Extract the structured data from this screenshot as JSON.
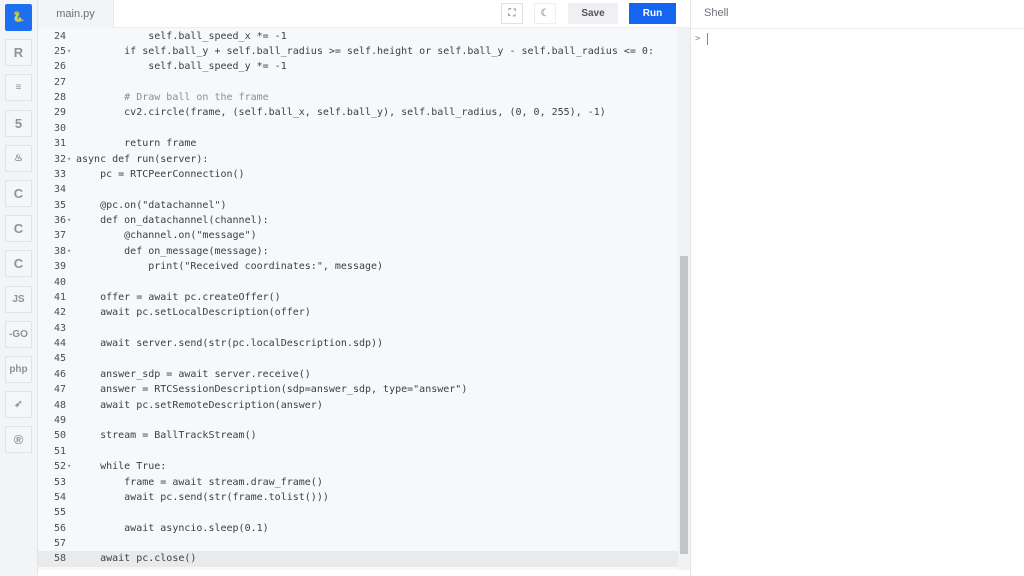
{
  "sidebar": {
    "items": [
      {
        "icon": "python-icon",
        "glyph": "🐍",
        "active": true
      },
      {
        "icon": "r-icon",
        "glyph": "R"
      },
      {
        "icon": "database-icon",
        "glyph": "≡"
      },
      {
        "icon": "html5-icon",
        "glyph": "5"
      },
      {
        "icon": "java-icon",
        "glyph": "♨"
      },
      {
        "icon": "c-icon",
        "glyph": "C"
      },
      {
        "icon": "cpp-icon",
        "glyph": "C"
      },
      {
        "icon": "csharp-icon",
        "glyph": "C"
      },
      {
        "icon": "javascript-icon",
        "glyph": "JS"
      },
      {
        "icon": "go-icon",
        "glyph": "-GO"
      },
      {
        "icon": "php-icon",
        "glyph": "php"
      },
      {
        "icon": "swift-icon",
        "glyph": "➶"
      },
      {
        "icon": "rust-icon",
        "glyph": "®"
      }
    ]
  },
  "header": {
    "tab": "main.py",
    "fullscreen_icon": "⛶",
    "theme_icon": "☾",
    "save_label": "Save",
    "run_label": "Run"
  },
  "editor": {
    "current_line": 58,
    "scroll_fraction": {
      "start": 0.42,
      "end": 0.97
    },
    "lines": [
      {
        "n": 24,
        "text": "            self.ball_speed_x *= -1"
      },
      {
        "n": 25,
        "fold": true,
        "text": "        if self.ball_y + self.ball_radius >= self.height or self.ball_y - self.ball_radius <= 0:"
      },
      {
        "n": 26,
        "text": "            self.ball_speed_y *= -1"
      },
      {
        "n": 27,
        "text": ""
      },
      {
        "n": 28,
        "text": "        # Draw ball on the frame"
      },
      {
        "n": 29,
        "text": "        cv2.circle(frame, (self.ball_x, self.ball_y), self.ball_radius, (0, 0, 255), -1)"
      },
      {
        "n": 30,
        "text": ""
      },
      {
        "n": 31,
        "text": "        return frame"
      },
      {
        "n": 32,
        "fold": true,
        "text": "async def run(server):"
      },
      {
        "n": 33,
        "text": "    pc = RTCPeerConnection()"
      },
      {
        "n": 34,
        "text": ""
      },
      {
        "n": 35,
        "text": "    @pc.on(\"datachannel\")"
      },
      {
        "n": 36,
        "fold": true,
        "text": "    def on_datachannel(channel):"
      },
      {
        "n": 37,
        "text": "        @channel.on(\"message\")"
      },
      {
        "n": 38,
        "fold": true,
        "text": "        def on_message(message):"
      },
      {
        "n": 39,
        "text": "            print(\"Received coordinates:\", message)"
      },
      {
        "n": 40,
        "text": ""
      },
      {
        "n": 41,
        "text": "    offer = await pc.createOffer()"
      },
      {
        "n": 42,
        "text": "    await pc.setLocalDescription(offer)"
      },
      {
        "n": 43,
        "text": ""
      },
      {
        "n": 44,
        "text": "    await server.send(str(pc.localDescription.sdp))"
      },
      {
        "n": 45,
        "text": ""
      },
      {
        "n": 46,
        "text": "    answer_sdp = await server.receive()"
      },
      {
        "n": 47,
        "text": "    answer = RTCSessionDescription(sdp=answer_sdp, type=\"answer\")"
      },
      {
        "n": 48,
        "text": "    await pc.setRemoteDescription(answer)"
      },
      {
        "n": 49,
        "text": ""
      },
      {
        "n": 50,
        "text": "    stream = BallTrackStream()"
      },
      {
        "n": 51,
        "text": ""
      },
      {
        "n": 52,
        "fold": true,
        "text": "    while True:"
      },
      {
        "n": 53,
        "text": "        frame = await stream.draw_frame()"
      },
      {
        "n": 54,
        "text": "        await pc.send(str(frame.tolist()))"
      },
      {
        "n": 55,
        "text": ""
      },
      {
        "n": 56,
        "text": "        await asyncio.sleep(0.1)"
      },
      {
        "n": 57,
        "text": ""
      },
      {
        "n": 58,
        "text": "    await pc.close()"
      }
    ]
  },
  "shell": {
    "title": "Shell",
    "prompt": ">"
  }
}
